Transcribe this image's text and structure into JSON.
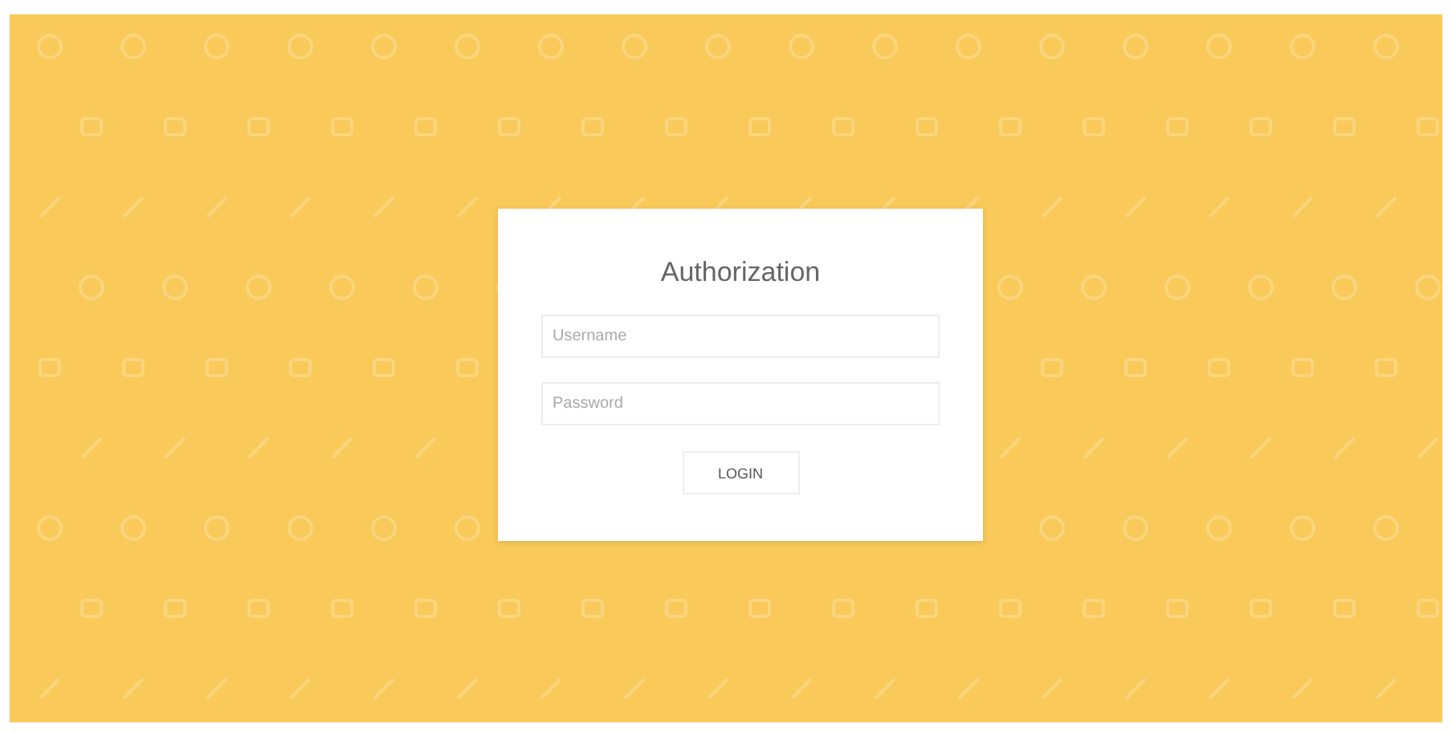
{
  "login_card": {
    "title": "Authorization",
    "fields": [
      {
        "placeholder": "Username"
      },
      {
        "placeholder": "Password"
      }
    ],
    "button": "LOGIN"
  }
}
